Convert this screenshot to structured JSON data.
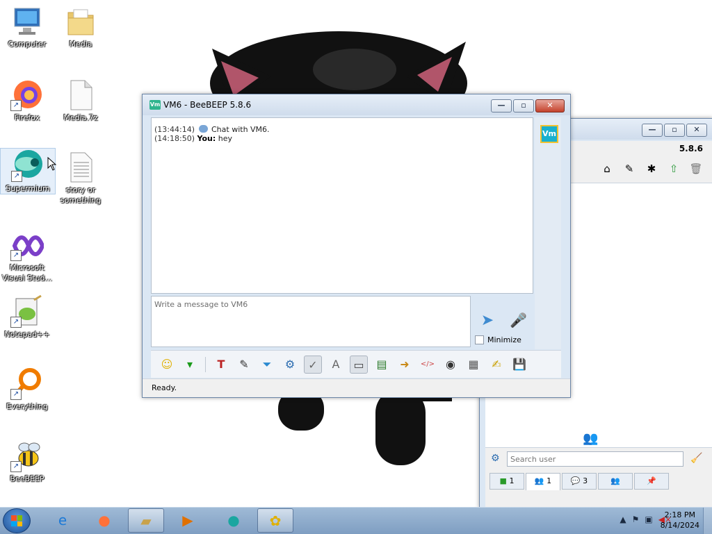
{
  "desktop": {
    "icons": [
      {
        "label": "Computer",
        "icon": "computer-icon"
      },
      {
        "label": "Media",
        "icon": "folder-icon"
      },
      {
        "label": "Firefox",
        "icon": "firefox-icon"
      },
      {
        "label": "Media.7z",
        "icon": "file-icon"
      },
      {
        "label": "Supermium",
        "icon": "supermium-icon"
      },
      {
        "label": "story or something",
        "icon": "text-file-icon"
      },
      {
        "label": "Microsoft Visual Stud...",
        "icon": "visual-studio-icon"
      },
      {
        "label": "Notepad++",
        "icon": "notepadpp-icon"
      },
      {
        "label": "Everything",
        "icon": "everything-icon"
      },
      {
        "label": "BeeBEEP",
        "icon": "beebeep-icon"
      }
    ]
  },
  "chat_window": {
    "app_icon_text": "Vm",
    "title": "VM6 - BeeBEEP 5.8.6",
    "messages": [
      {
        "time": "(13:44:14)",
        "sender": "",
        "text": "Chat with VM6."
      },
      {
        "time": "(14:18:50)",
        "sender": "You:",
        "text": "hey"
      }
    ],
    "side_badge": "Vm",
    "input_placeholder": "Write a message to VM6",
    "minimize_label": "Minimize",
    "status": "Ready.",
    "toolbar_icons": [
      "emoticon-icon",
      "green-arrow-icon",
      "font-icon",
      "color-icon",
      "filter-icon",
      "settings-gear-icon",
      "spellcheck-icon",
      "font-size-icon",
      "compact-icon",
      "save-chat-icon",
      "export-icon",
      "html-icon",
      "screenshot-icon",
      "keyboard-icon",
      "notes-icon",
      "save-icon"
    ]
  },
  "main_window": {
    "version": "5.8.6",
    "search_placeholder": "Search user",
    "tabs": [
      {
        "icon": "users-online-icon",
        "count": "1"
      },
      {
        "icon": "group-icon",
        "count": "1"
      },
      {
        "icon": "chats-icon",
        "count": "3"
      },
      {
        "icon": "groups-icon",
        "count": ""
      },
      {
        "icon": "pin-icon",
        "count": ""
      }
    ]
  },
  "taskbar": {
    "clock_time": "2:18 PM",
    "clock_date": "8/14/2024",
    "items": [
      "ie-icon",
      "firefox-icon",
      "explorer-icon",
      "media-player-icon",
      "supermium-icon",
      "beebeep-icon"
    ]
  }
}
